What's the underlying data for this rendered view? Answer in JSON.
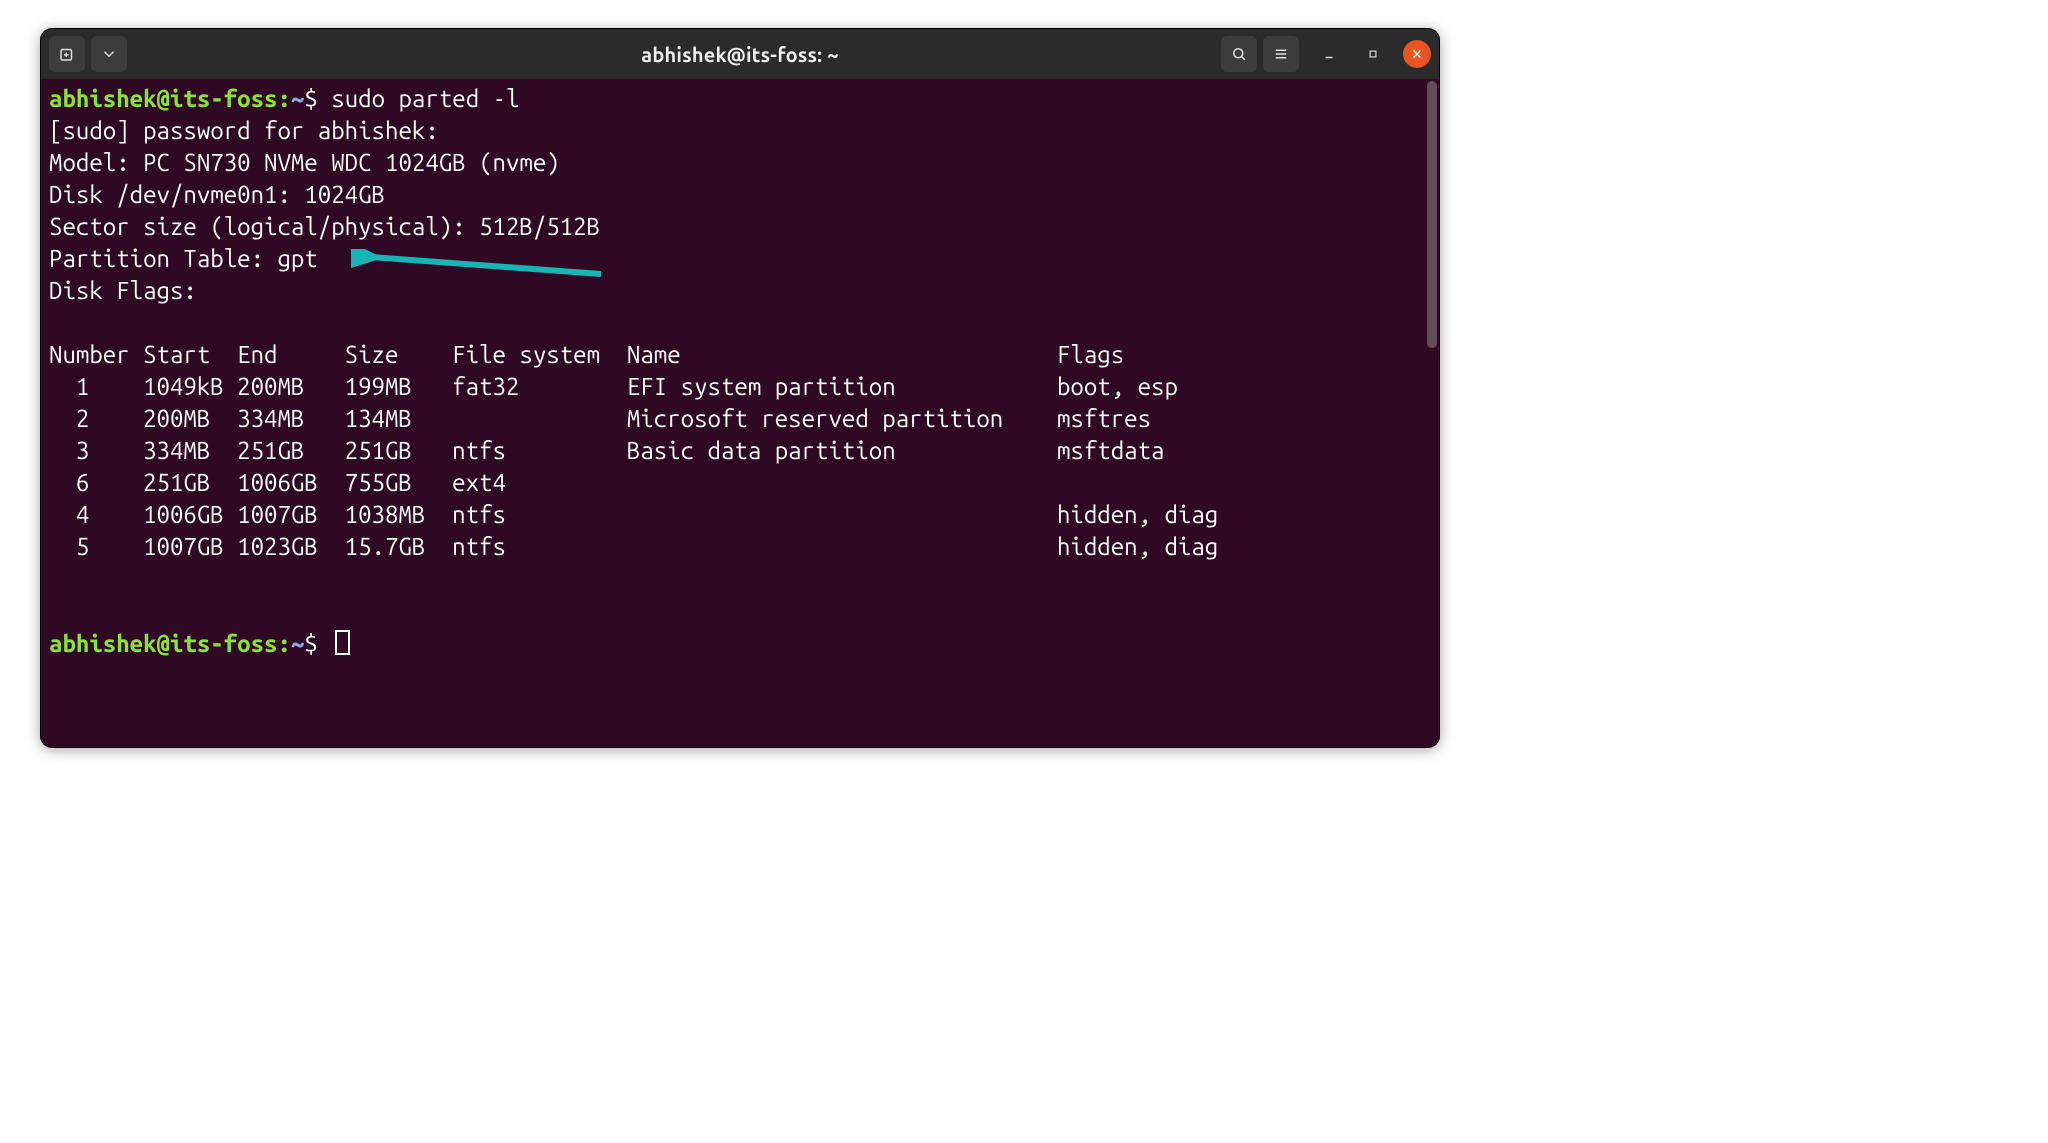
{
  "window": {
    "title": "abhishek@its-foss: ~"
  },
  "prompt": {
    "user_host": "abhishek@its-foss",
    "colon": ":",
    "path": "~",
    "symbol": "$"
  },
  "command": "sudo parted -l",
  "output": {
    "sudo_prompt": "[sudo] password for abhishek:",
    "model": "Model: PC SN730 NVMe WDC 1024GB (nvme)",
    "disk": "Disk /dev/nvme0n1: 1024GB",
    "sector": "Sector size (logical/physical): 512B/512B",
    "ptable": "Partition Table: gpt",
    "dflags": "Disk Flags:"
  },
  "table": {
    "headers": {
      "number": "Number",
      "start": "Start",
      "end": "End",
      "size": "Size",
      "fs": "File system",
      "name": "Name",
      "flags": "Flags"
    },
    "rows": [
      {
        "number": "1",
        "start": "1049kB",
        "end": "200MB",
        "size": "199MB",
        "fs": "fat32",
        "name": "EFI system partition",
        "flags": "boot, esp"
      },
      {
        "number": "2",
        "start": "200MB",
        "end": "334MB",
        "size": "134MB",
        "fs": "",
        "name": "Microsoft reserved partition",
        "flags": "msftres"
      },
      {
        "number": "3",
        "start": "334MB",
        "end": "251GB",
        "size": "251GB",
        "fs": "ntfs",
        "name": "Basic data partition",
        "flags": "msftdata"
      },
      {
        "number": "6",
        "start": "251GB",
        "end": "1006GB",
        "size": "755GB",
        "fs": "ext4",
        "name": "",
        "flags": ""
      },
      {
        "number": "4",
        "start": "1006GB",
        "end": "1007GB",
        "size": "1038MB",
        "fs": "ntfs",
        "name": "",
        "flags": "hidden, diag"
      },
      {
        "number": "5",
        "start": "1007GB",
        "end": "1023GB",
        "size": "15.7GB",
        "fs": "ntfs",
        "name": "",
        "flags": "hidden, diag"
      }
    ]
  },
  "annotation": {
    "arrow_color": "#17b5b5"
  }
}
